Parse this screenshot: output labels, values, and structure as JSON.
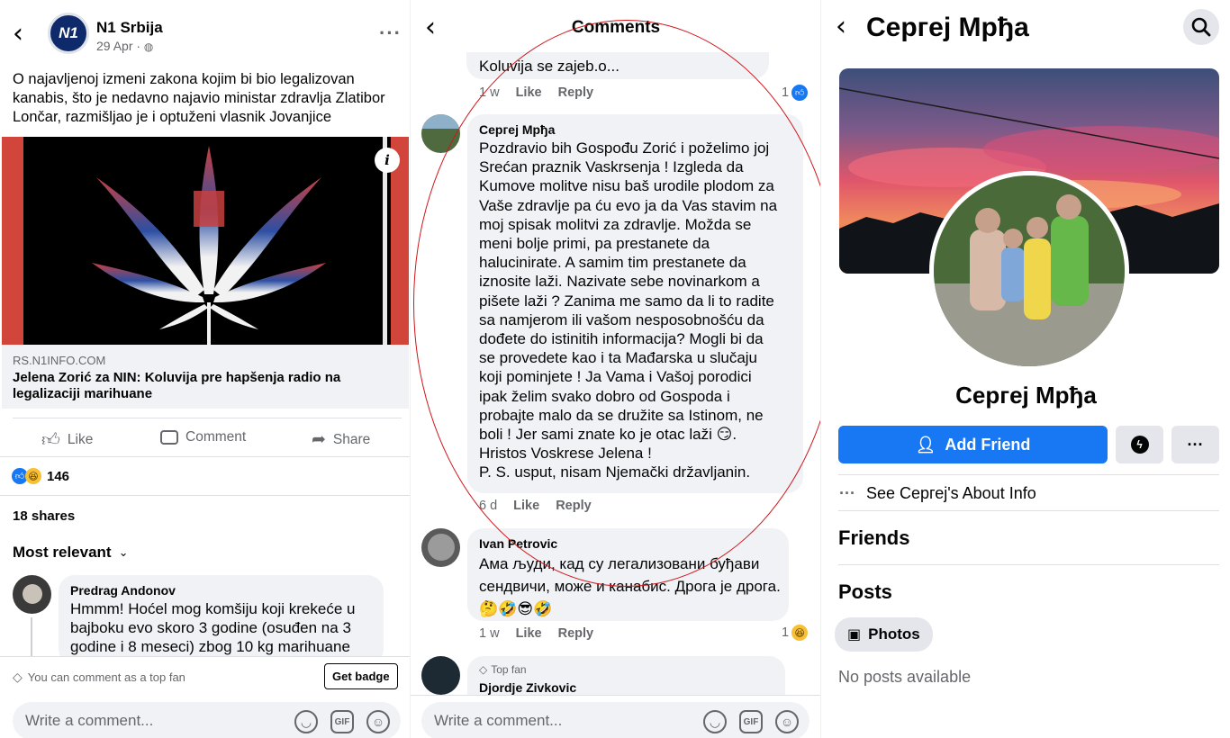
{
  "post_panel": {
    "page_name": "N1 Srbija",
    "logo_text": "N1",
    "date": "29 Apr · ",
    "globe_icon": "globe-icon",
    "more_label": "···",
    "post_text": "O najavljenoj izmeni zakona kojim bi bio legalizovan kanabis, što je nedavno najavio ministar zdravlja Zlatibor Lončar, razmišljao je i optuženi vlasnik Jovanjice",
    "link_domain": "RS.N1INFO.COM",
    "link_title": "Jelena Zorić za NIN: Koluvija pre hapšenja radio na legalizaciji marihuane",
    "info_icon": "i",
    "actions": {
      "like": "Like",
      "comment": "Comment",
      "share": "Share"
    },
    "reaction_count": "146",
    "shares": "18 shares",
    "sort_label": "Most relevant",
    "first_comment": {
      "author": "Predrag Andonov",
      "text": "Hmmm! Hoćel mog komšiju koji krekeće u bajboku evo skoro 3 godine (osuđen na 3 godine i 8 meseci) zbog 10 kg marihuane"
    },
    "top_fan_notice": "You can comment as a top fan",
    "get_badge": "Get badge",
    "write_placeholder": "Write a comment..."
  },
  "comments_panel": {
    "title": "Comments",
    "prev_comment_tail": "Koluvija se zajeb.o...",
    "prev_meta": {
      "time": "1 w",
      "like": "Like",
      "reply": "Reply",
      "reactions": "1"
    },
    "main_comment": {
      "author": "Сергеј Мрђа",
      "text": "Pozdravio bih Gospođu Zorić i poželimo joj\nSrećan praznik Vaskrsenja ! Izgleda da\nKumove molitve nisu baš urodile plodom za\nVaše zdravlje pa ću evo ja da Vas stavim na\nmoj spisak molitvi za zdravlje. Možda se\nmeni bolje primi, pa prestanete da\nhalucinirate. A samim tim prestanete da\niznosite laži. Nazivate sebe novinarkom a\npišete laži ? Zanima me samo da li to radite\nsa namjerom ili vašom nesposobnošću da\ndođete do istinitih informacija? Mogli bi da\nse provedete kao i ta Mađarska u slučaju\nkoji pominjete !  Ja Vama i Vašoj porodici\nipak želim svako dobro od Gospoda i\nprobajte malo da se družite sa Istinom, ne\nboli ! Jer sami znate ko je otac laži 😏.\nHristos Voskrese Jelena !\nP. S. usput, nisam Njemački državljanin.",
      "meta": {
        "time": "6 d",
        "like": "Like",
        "reply": "Reply"
      }
    },
    "second_comment": {
      "author": "Ivan Petrovic",
      "text": "Ама људи, кад су легализовани буђави сендвичи, може и канабис. Дрога је дрога.🤔🤣😎🤣",
      "meta": {
        "time": "1 w",
        "like": "Like",
        "reply": "Reply",
        "reactions": "1"
      }
    },
    "third_comment": {
      "badge": "Top fan",
      "author": "Djordje Zivkovic"
    },
    "write_placeholder": "Write a comment..."
  },
  "profile_panel": {
    "name_header": "Сергеј Мрђа",
    "profile_name": "Сергеј Мрђа",
    "add_friend": "Add Friend",
    "more": "···",
    "about": "See Сергеј's About Info",
    "friends_heading": "Friends",
    "posts_heading": "Posts",
    "photos_chip": "Photos",
    "no_posts": "No posts available"
  },
  "colors": {
    "facebook_blue": "#1877f2",
    "annotation_red": "#d0161b",
    "bubble_gray": "#f0f2f5"
  }
}
